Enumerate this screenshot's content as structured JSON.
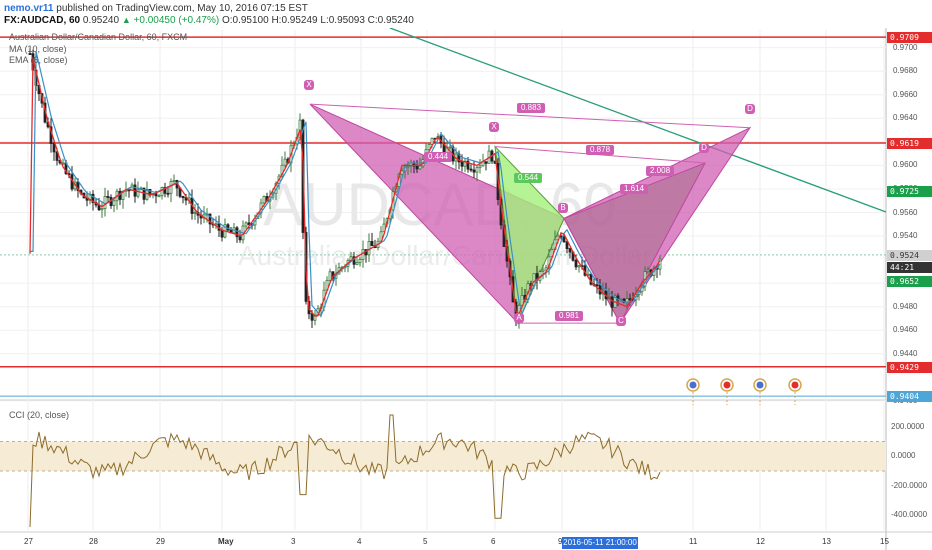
{
  "header": {
    "author": "nemo.vr11",
    "published": "published on TradingView.com, May 10, 2016 07:15 EST",
    "symbol": "FX:AUDCAD, 60",
    "last": "0.95240",
    "change": "+0.00450 (+0.47%)",
    "open": "O:0.95100",
    "high": "H:0.95249",
    "low": "L:0.95093",
    "close": "C:0.95240"
  },
  "legend": {
    "name": "Australian Dollar/Canadian Dollar, 60, FXCM",
    "ma": "MA (10, close)",
    "ema": "EMA (6, close)"
  },
  "watermark": {
    "symbol": "AUDCAD, 60",
    "name": "Australian Dollar/Canadian Dollar"
  },
  "price_axis": {
    "ticks": [
      "0.9700",
      "0.9680",
      "0.9660",
      "0.9640",
      "0.9620",
      "0.9600",
      "0.9580",
      "0.9560",
      "0.9540",
      "0.9500",
      "0.9480",
      "0.9460",
      "0.9440",
      "0.9400"
    ],
    "badges": [
      {
        "label": "0.9709",
        "price": 0.9709,
        "color": "#e52c2c"
      },
      {
        "label": "0.9619",
        "price": 0.9619,
        "color": "#e52c2c"
      },
      {
        "label": "0.9725",
        "price": 0.9578,
        "color": "#1aa04a"
      },
      {
        "label": "0.9524",
        "price": 0.9524,
        "color": "#d0d0d0"
      },
      {
        "label": "44:21",
        "price": 0.9514,
        "color": "#333333"
      },
      {
        "label": "0.9652",
        "price": 0.9502,
        "color": "#1aa04a"
      },
      {
        "label": "0.9429",
        "price": 0.9429,
        "color": "#e52c2c"
      },
      {
        "label": "0.9404",
        "price": 0.9404,
        "color": "#4da6d6"
      }
    ]
  },
  "cci": {
    "title": "CCI (20, close)",
    "ticks": [
      "200.0000",
      "0.0000",
      "-200.0000",
      "-400.0000"
    ]
  },
  "time_axis": {
    "labels": [
      "27",
      "28",
      "29",
      "May",
      "3",
      "4",
      "5",
      "6",
      "9",
      "11",
      "12",
      "13",
      "15"
    ],
    "selected": "2016-05-11 21:00:00"
  },
  "chart_data": {
    "type": "candlestick",
    "y_range": [
      0.9405,
      0.9715
    ],
    "horizontal_levels": [
      0.9709,
      0.9619,
      0.9429,
      0.9404
    ],
    "harmonic_points": [
      "X",
      "A",
      "B",
      "C",
      "D",
      "X",
      "D"
    ],
    "ratios": [
      "0.883",
      "0.878",
      "0.544",
      "0.444",
      "2.008",
      "1.614",
      "0.981"
    ],
    "cci_range": [
      -500,
      300
    ]
  }
}
